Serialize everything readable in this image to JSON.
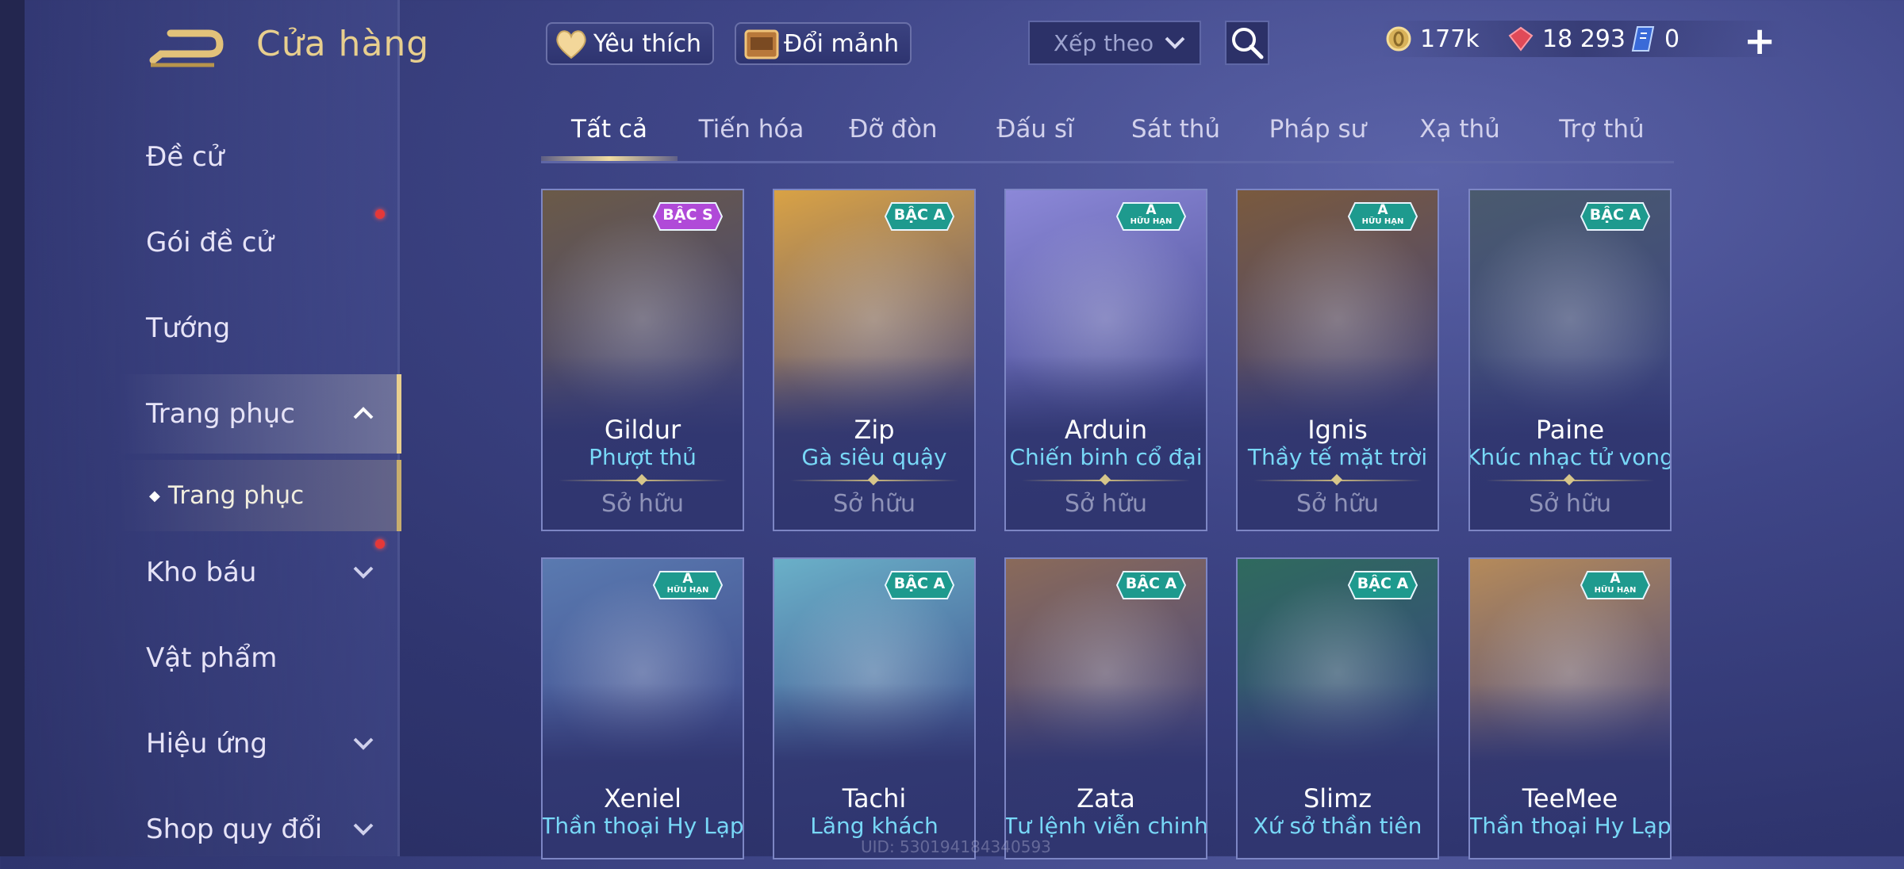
{
  "header": {
    "title": "Cửa hàng",
    "favorite_label": "Yêu thích",
    "exchange_label": "Đổi mảnh",
    "sort_placeholder": "Xếp theo"
  },
  "currencies": [
    {
      "icon": "gold-coin-icon",
      "value": "177k"
    },
    {
      "icon": "ruby-gem-icon",
      "value": "18 293"
    },
    {
      "icon": "voucher-icon",
      "value": "0"
    }
  ],
  "sidebar": {
    "items": [
      {
        "label": "Đề cử"
      },
      {
        "label": "Gói đề cử"
      },
      {
        "label": "Tướng"
      },
      {
        "label": "Trang phục"
      },
      {
        "label": "Kho báu"
      },
      {
        "label": "Vật phẩm"
      },
      {
        "label": "Hiệu ứng"
      },
      {
        "label": "Shop quy đổi"
      }
    ],
    "sub_item": "Trang phục"
  },
  "tabs": [
    "Tất cả",
    "Tiến hóa",
    "Đỡ đòn",
    "Đấu sĩ",
    "Sát thủ",
    "Pháp sư",
    "Xạ thủ",
    "Trợ thủ"
  ],
  "cards": [
    {
      "hero": "Gildur",
      "skin": "Phượt thủ",
      "status": "Sở hữu",
      "badge": "BẬC S",
      "art": "#6b5a48"
    },
    {
      "hero": "Zip",
      "skin": "Gà siêu quậy",
      "status": "Sở hữu",
      "badge": "BẬC A",
      "art": "#d9a245"
    },
    {
      "hero": "Arduin",
      "skin": "Chiến binh cổ đại",
      "status": "Sở hữu",
      "badge_top": "A",
      "badge_bottom": "HỮU HẠN",
      "art": "#8c88d8"
    },
    {
      "hero": "Ignis",
      "skin": "Thầy tế mặt trời",
      "status": "Sở hữu",
      "badge_top": "A",
      "badge_bottom": "HỮU HẠN",
      "art": "#7a5a3e"
    },
    {
      "hero": "Paine",
      "skin": "Khúc nhạc tử vong",
      "status": "Sở hữu",
      "badge": "BẬC A",
      "art": "#4a5a6e"
    },
    {
      "hero": "Xeniel",
      "skin": "Thần thoại Hy Lạp",
      "badge_top": "A",
      "badge_bottom": "HỮU HẠN",
      "art": "#5a7ab0"
    },
    {
      "hero": "Tachi",
      "skin": "Lãng khách",
      "badge": "BẬC A",
      "art": "#6ab0c8"
    },
    {
      "hero": "Zata",
      "skin": "Tư lệnh viễn chinh",
      "badge": "BẬC A",
      "art": "#8a6a5a"
    },
    {
      "hero": "Slimz",
      "skin": "Xứ sở thần tiên",
      "badge": "BẬC A",
      "art": "#2f6a5e"
    },
    {
      "hero": "TeeMee",
      "skin": "Thần thoại Hy Lạp",
      "badge_top": "A",
      "badge_bottom": "HỮU HẠN",
      "art": "#b58a5a"
    }
  ],
  "uid_text": "UID: 530194184340593",
  "colors": {
    "accent_gold": "#e8cf8e",
    "skin_name": "#78d8f7",
    "badge_s": "#b04ad8",
    "badge_a": "#1e9a8e",
    "notify": "#e53838"
  }
}
